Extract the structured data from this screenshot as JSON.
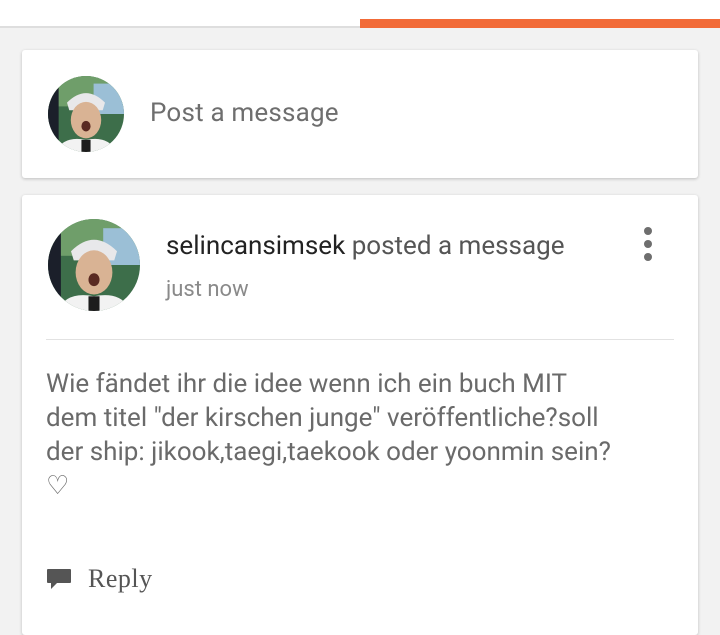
{
  "tabs": {
    "active_accent": "#f26b38"
  },
  "compose": {
    "placeholder": "Post a message"
  },
  "post": {
    "author": "selincansimsek",
    "action": " posted a message",
    "time": "just now",
    "body": "Wie fändet ihr die idee wenn ich ein buch MIT\ndem titel \"der kirschen junge\" veröffentliche?soll\nder ship: jikook,taegi,taekook oder yoonmin sein?\n♡",
    "more_icon": "more-vert-icon",
    "reply_label": "Reply",
    "reply_icon": "speech-bubble-icon"
  }
}
